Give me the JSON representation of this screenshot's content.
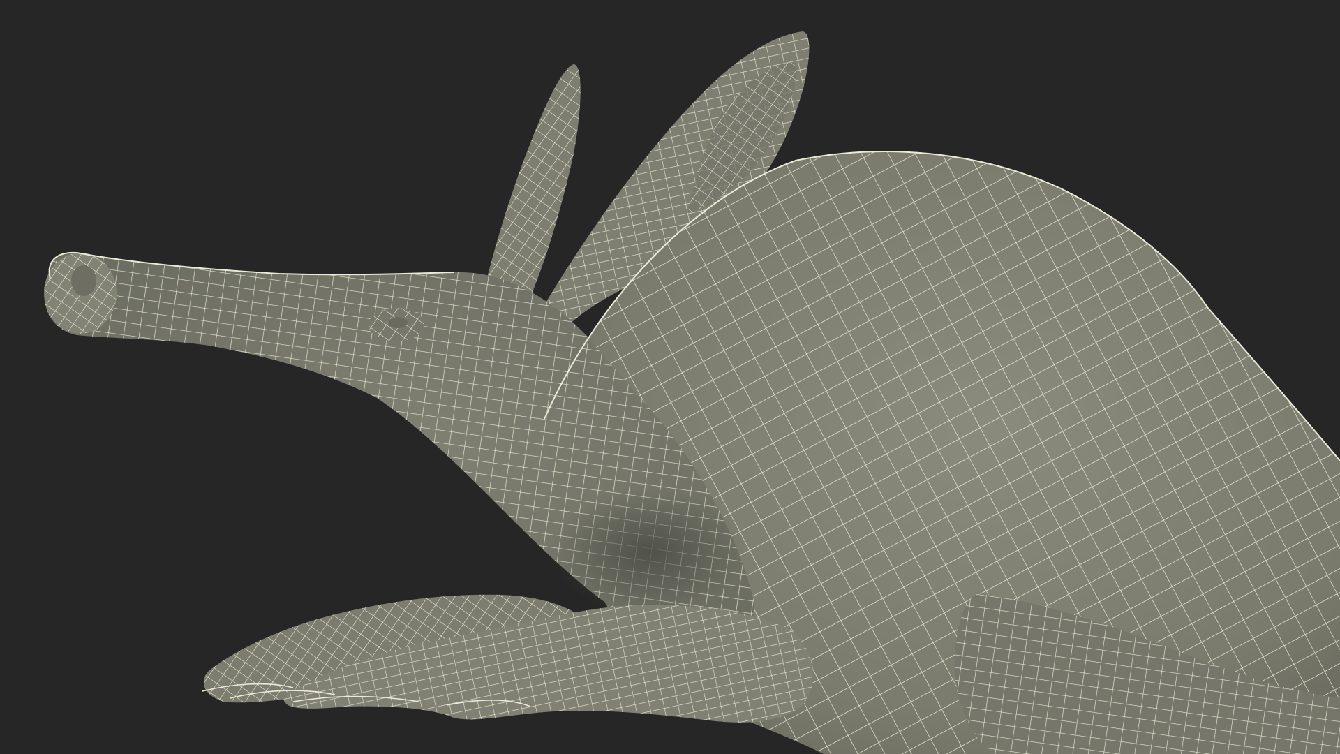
{
  "scene": {
    "subject": "aardvark-wireframe-model",
    "colors": {
      "background": "#262626",
      "surface": "#7d7e70",
      "surface_light": "#8e8f80",
      "surface_shadow": "#5a5b50",
      "wire": "#ecebd8"
    }
  }
}
